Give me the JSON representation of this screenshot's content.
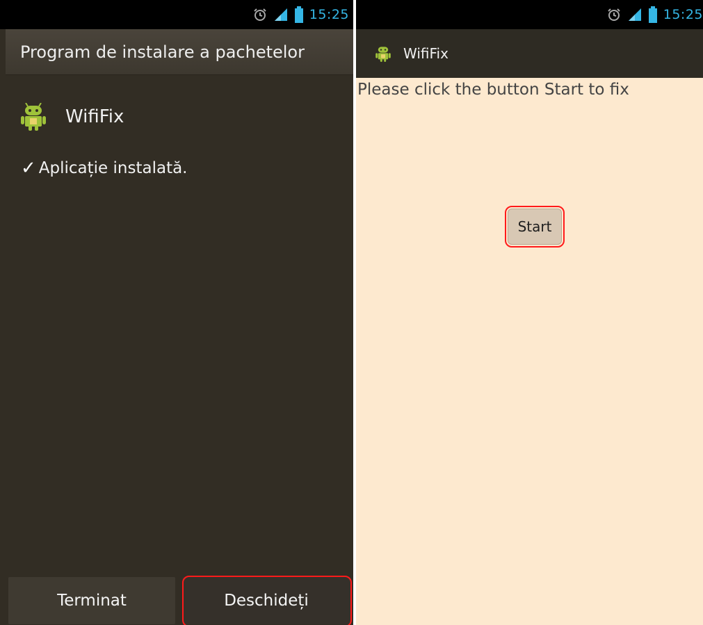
{
  "left_screen": {
    "status_bar": {
      "time": "15:25",
      "icons": [
        "alarm-icon",
        "signal-icon",
        "battery-icon"
      ]
    },
    "header_title": "Program de instalare a pachetelor",
    "app_name": "WifiFix",
    "installed_message": "Aplicație instalată.",
    "buttons": {
      "done_label": "Terminat",
      "open_label": "Deschideți"
    }
  },
  "right_screen": {
    "status_bar": {
      "time": "15:25",
      "icons": [
        "alarm-icon",
        "signal-icon",
        "battery-icon"
      ]
    },
    "app_bar_title": "WifiFix",
    "message": "Please click the button Start to fix",
    "start_label": "Start"
  },
  "colors": {
    "installer_bg": "#322d24",
    "app_bg": "#fde9cf",
    "status_time": "#35b6e5",
    "highlight": "#ff1a1a"
  }
}
